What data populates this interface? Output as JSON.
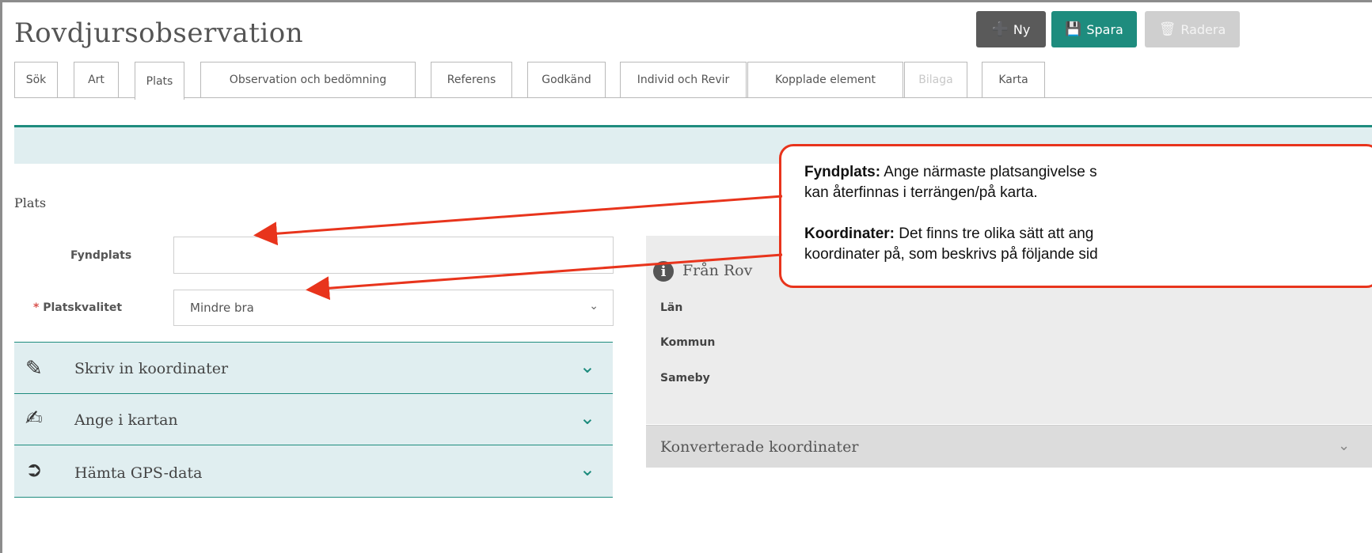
{
  "app_title": "Rovdjursobservation",
  "toolbar": {
    "new_label": "Ny",
    "save_label": "Spara",
    "delete_label": "Radera"
  },
  "tabs": [
    {
      "label": "Sök"
    },
    {
      "label": "Art"
    },
    {
      "label": "Plats"
    },
    {
      "label": "Observation och bedömning"
    },
    {
      "label": "Referens"
    },
    {
      "label": "Godkänd"
    },
    {
      "label": "Individ och Revir"
    },
    {
      "label": "Kopplade element"
    },
    {
      "label": "Bilaga"
    },
    {
      "label": "Karta"
    }
  ],
  "active_tab": "Plats",
  "section_title": "Plats",
  "form": {
    "fyndplats_label": "Fyndplats",
    "fyndplats_value": "",
    "required_mark": "*",
    "platskvalitet_label": "Platskvalitet",
    "platskvalitet_value": "Mindre bra"
  },
  "accordions": [
    {
      "label": "Skriv in koordinater",
      "icon": "pencil-coordinates-icon"
    },
    {
      "label": "Ange i kartan",
      "icon": "map-pen-add-icon"
    },
    {
      "label": "Hämta GPS-data",
      "icon": "gps-import-icon"
    }
  ],
  "info_panel": {
    "heading_visible": "Från Rov",
    "lan_label": "Län",
    "kommun_label": "Kommun",
    "sameby_label": "Sameby",
    "converted_label": "Konverterade koordinater"
  },
  "callout": {
    "line1_bold": "Fyndplats:",
    "line1_text": " Ange närmaste platsangivelse s",
    "line2": "kan återfinnas i terrängen/på karta.",
    "line3_bold": "Koordinater:",
    "line3_text": " Det finns tre olika sätt att ang",
    "line4": "koordinater på, som beskrivs på följande sid"
  },
  "colors": {
    "accent": "#1e8c7e",
    "callout_border": "#e8341c",
    "accordion_bg": "#e0eef0"
  }
}
